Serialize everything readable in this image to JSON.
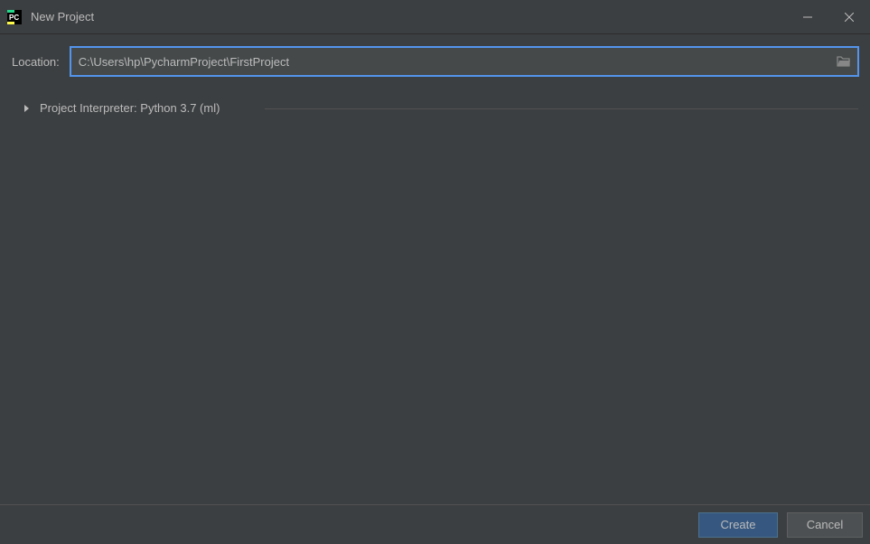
{
  "window": {
    "title": "New Project"
  },
  "form": {
    "location_label": "Location:",
    "location_value": "C:\\Users\\hp\\PycharmProject\\FirstProject",
    "interpreter_label": "Project Interpreter: Python 3.7 (ml)"
  },
  "buttons": {
    "create": "Create",
    "cancel": "Cancel"
  }
}
